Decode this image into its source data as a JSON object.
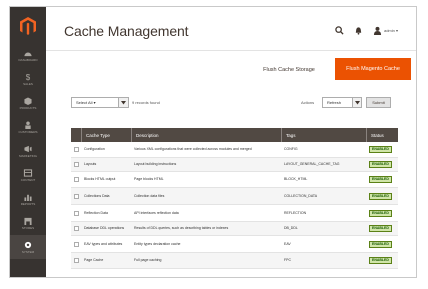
{
  "window": {
    "title": "Cache Management"
  },
  "sidebar": {
    "logo": "magento-logo-icon",
    "items": [
      {
        "label": "Dashboard",
        "icon": "dashboard-icon"
      },
      {
        "label": "Sales",
        "icon": "dollar-icon"
      },
      {
        "label": "Products",
        "icon": "cube-icon"
      },
      {
        "label": "Customers",
        "icon": "person-icon"
      },
      {
        "label": "Marketing",
        "icon": "megaphone-icon"
      },
      {
        "label": "Content",
        "icon": "layout-icon"
      },
      {
        "label": "Reports",
        "icon": "bar-chart-icon"
      },
      {
        "label": "Stores",
        "icon": "store-icon"
      },
      {
        "label": "System",
        "icon": "gear-icon"
      }
    ]
  },
  "header": {
    "search_icon": "search-icon",
    "notifications_icon": "bell-icon",
    "user_icon": "user-icon",
    "user_name": "admin ▾"
  },
  "actions": {
    "flush_storage": "Flush Cache Storage",
    "flush_magento": "Flush Magento Cache"
  },
  "toolbar": {
    "mass_select": "Select All ▾",
    "records": "9 records found",
    "action_label": "Actions",
    "action_value": "Refresh",
    "submit": "Submit"
  },
  "grid": {
    "columns": [
      "",
      "Cache Type",
      "Description",
      "Tags",
      "Status"
    ],
    "rows": [
      {
        "type": "Configuration",
        "description": "Various XML configurations that were collected across modules and merged",
        "tags": "CONFIG",
        "status": "ENABLED"
      },
      {
        "type": "Layouts",
        "description": "Layout building instructions",
        "tags": "LAYOUT_GENERAL_CACHE_TAG",
        "status": "ENABLED"
      },
      {
        "type": "Blocks HTML output",
        "description": "Page blocks HTML",
        "tags": "BLOCK_HTML",
        "status": "ENABLED"
      },
      {
        "type": "Collections Data",
        "description": "Collection data files",
        "tags": "COLLECTION_DATA",
        "status": "ENABLED"
      },
      {
        "type": "Reflection Data",
        "description": "API interfaces reflection data",
        "tags": "REFLECTION",
        "status": "ENABLED"
      },
      {
        "type": "Database DDL operations",
        "description": "Results of DDL queries, such as describing tables or indexes",
        "tags": "DB_DDL",
        "status": "ENABLED"
      },
      {
        "type": "EAV types and attributes",
        "description": "Entity types declaration cache",
        "tags": "EAV",
        "status": "ENABLED"
      },
      {
        "type": "Page Cache",
        "description": "Full page caching",
        "tags": "FPC",
        "status": "ENABLED"
      }
    ]
  },
  "colors": {
    "sidebar_bg": "#373330",
    "accent": "#eb5202",
    "grid_header": "#514943",
    "status_ok": "#d0e5a9"
  }
}
